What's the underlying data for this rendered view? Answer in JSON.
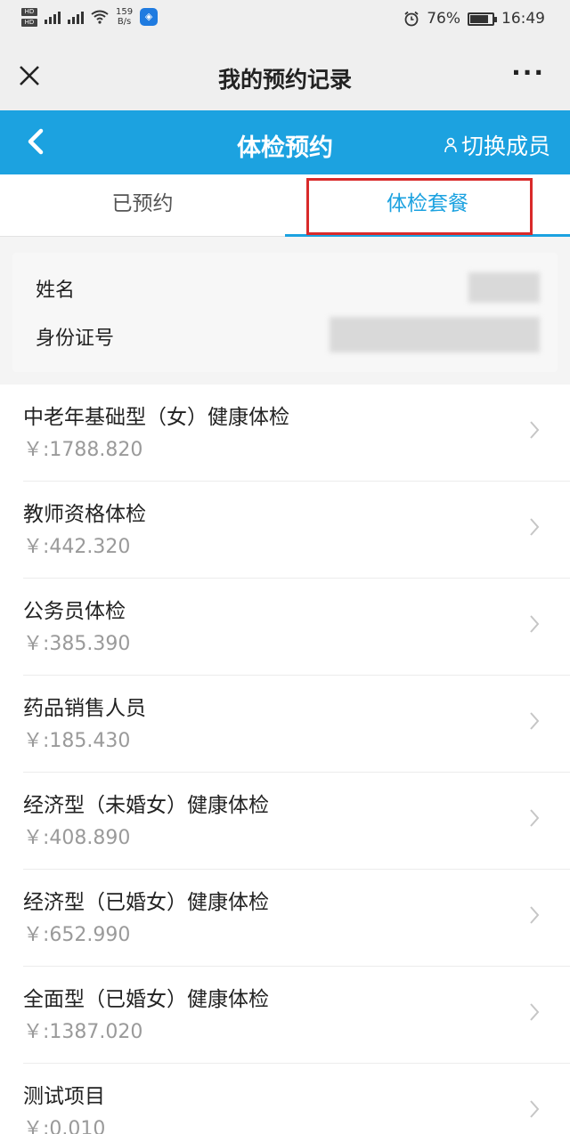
{
  "status_bar": {
    "network_speed": "159",
    "network_speed_unit": "B/s",
    "battery": "76%",
    "battery_fraction": 0.76,
    "time": "16:49"
  },
  "title_bar": {
    "title": "我的预约记录",
    "more": "···"
  },
  "header": {
    "title": "体检预约",
    "switch_member": "切换成员"
  },
  "tabs": [
    {
      "label": "已预约",
      "active": false
    },
    {
      "label": "体检套餐",
      "active": true
    }
  ],
  "info": {
    "name_label": "姓名",
    "id_label": "身份证号"
  },
  "packages": [
    {
      "name": "中老年基础型（女）健康体检",
      "price": "￥:1788.820"
    },
    {
      "name": "教师资格体检",
      "price": "￥:442.320"
    },
    {
      "name": "公务员体检",
      "price": "￥:385.390"
    },
    {
      "name": "药品销售人员",
      "price": "￥:185.430"
    },
    {
      "name": "经济型（未婚女）健康体检",
      "price": "￥:408.890"
    },
    {
      "name": "经济型（已婚女）健康体检",
      "price": "￥:652.990"
    },
    {
      "name": "全面型（已婚女）健康体检",
      "price": "￥:1387.020"
    },
    {
      "name": "测试项目",
      "price": "￥:0.010"
    }
  ],
  "colors": {
    "brand_blue": "#1ca2e0",
    "highlight_red": "#d92a2a"
  }
}
